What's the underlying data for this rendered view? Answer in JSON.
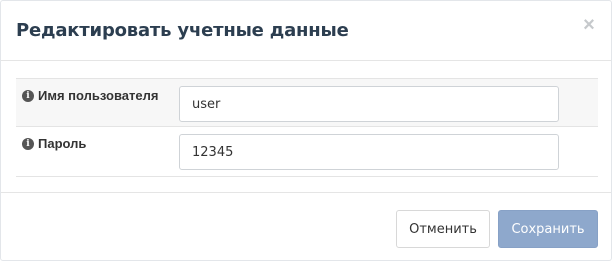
{
  "dialog": {
    "title": "Редактировать учетные данные",
    "close_icon": "×"
  },
  "fields": {
    "username": {
      "label": "Имя пользователя",
      "value": "user",
      "icon": "info-circle-icon"
    },
    "password": {
      "label": "Пароль",
      "value": "12345",
      "icon": "info-circle-icon"
    }
  },
  "footer": {
    "cancel_label": "Отменить",
    "save_label": "Сохранить"
  },
  "colors": {
    "save_button": "#8ea8cc",
    "title_text": "#2c3e50",
    "stripe_row": "#f7f7f7"
  }
}
